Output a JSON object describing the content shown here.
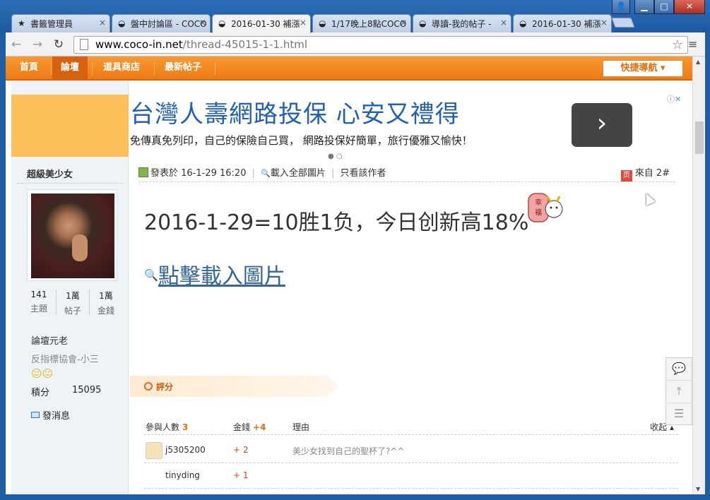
{
  "browser": {
    "tabs": [
      {
        "label": "書籤管理員",
        "icon": "★"
      },
      {
        "label": "盤中討論區 - COCO",
        "icon": "◒"
      },
      {
        "label": "2016-01-30 補漲",
        "icon": "◒"
      },
      {
        "label": "1/17晚上8點COCO",
        "icon": "◒"
      },
      {
        "label": "導讀-我的帖子 -",
        "icon": "◒"
      },
      {
        "label": "2016-01-30 補漲",
        "icon": "◒"
      }
    ],
    "tab_close": "×",
    "win_user": "👤",
    "win_min": "▁",
    "win_max": "□",
    "win_close": "✕",
    "back": "←",
    "forward": "→",
    "reload": "↻",
    "url_domain": "www.coco-in.net",
    "url_path": "/thread-45015-1-1.html",
    "star": "☆",
    "menu": "≡"
  },
  "site_nav": {
    "items": [
      "首頁",
      "論壇",
      "道具商店",
      "最新帖子"
    ],
    "quick_nav": "快捷導航 ▾"
  },
  "sidebar": {
    "username": "超級美少女",
    "stats": [
      {
        "num": "141",
        "label": "主題"
      },
      {
        "num": "1萬",
        "label": "帖子"
      },
      {
        "num": "1萬",
        "label": "金錢"
      }
    ],
    "rank": "論壇元老",
    "group": "反指標協會-小三",
    "smileys": "😐😐",
    "gold_label": "積分",
    "gold_value": "15095",
    "send_msg": "發消息"
  },
  "ad": {
    "title": "台灣人壽網路投保 心安又禮得",
    "desc": "免傳真免列印，自己的保險自己買， 網路投保好簡單，旅行優雅又愉快！",
    "button": "›",
    "dots": "● ○",
    "info": "ⓘ✕"
  },
  "post": {
    "posted_label": "發表於 16-1-29 16:20",
    "load_all": "載入全部圖片",
    "author_only": "只看該作者",
    "floor_label": "來自 2#",
    "floor_icon": "页",
    "content": "2016-1-29=10胜1负，今日创新高18%",
    "sticker_text": "幸福",
    "load_image_link": "點擊載入圖片",
    "mag": "🔍"
  },
  "rating": {
    "label": "評分",
    "col_participants": "參與人數",
    "participants_count": "3",
    "col_gold": "金錢",
    "gold_total": "+4",
    "col_reason": "理由",
    "collapse": "收起 ▴",
    "rows": [
      {
        "name": "j5305200",
        "gold": "+ 2",
        "reason": "美少女找到自己的聖杯了?^^"
      },
      {
        "name": "tinyding",
        "gold": "+ 1",
        "reason": ""
      }
    ]
  },
  "float_buttons": {
    "comment": "💬",
    "top": "⤒",
    "list": "☰"
  }
}
